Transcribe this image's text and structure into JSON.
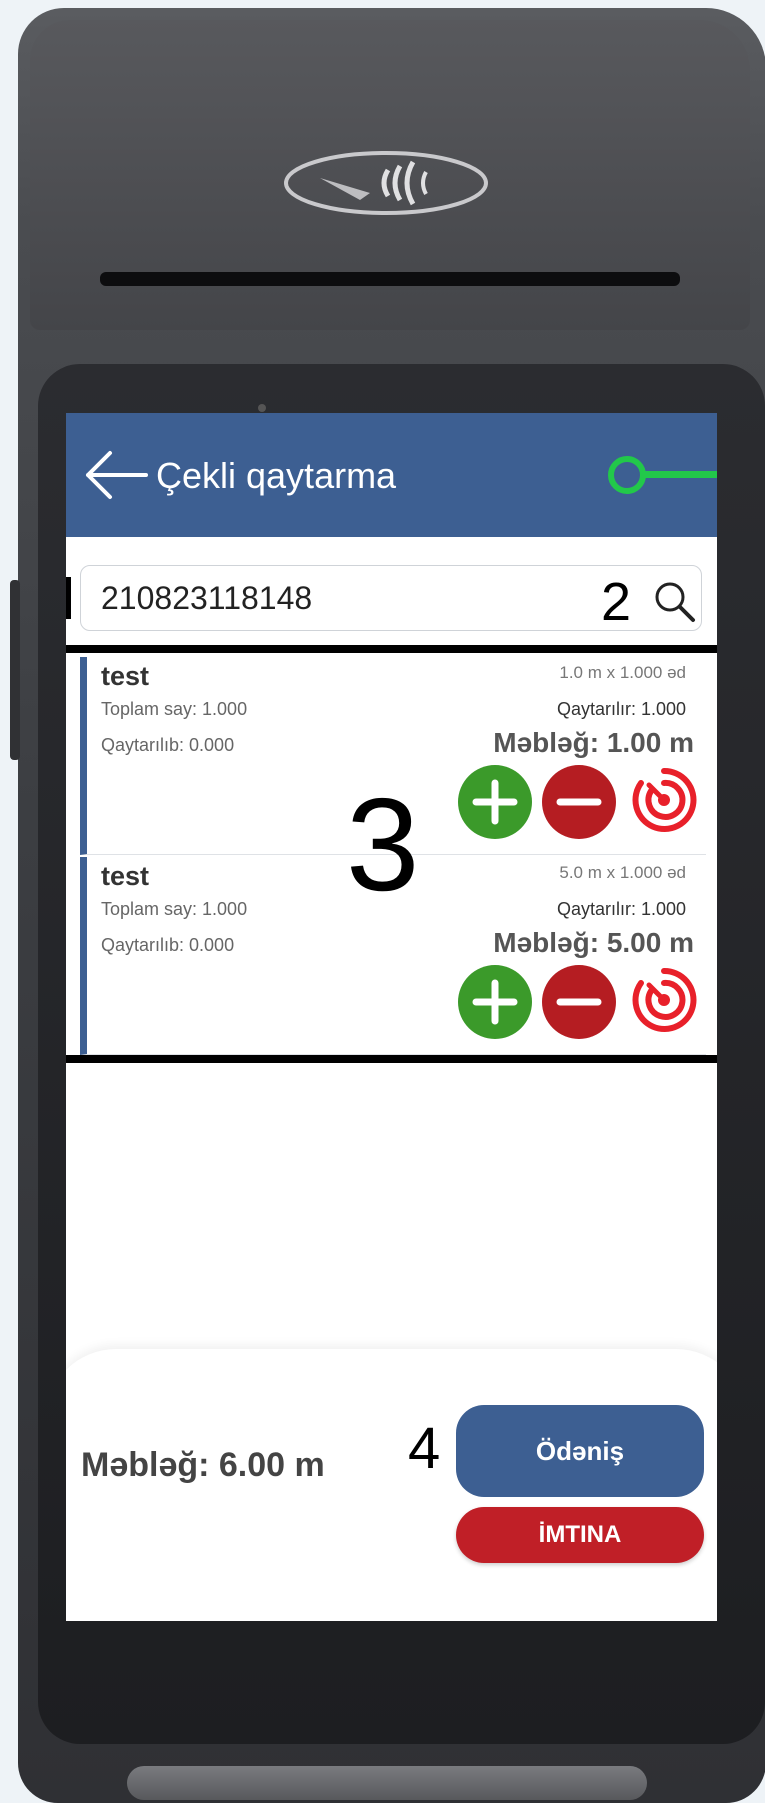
{
  "header": {
    "title": "Çekli qaytarma"
  },
  "search": {
    "value": "210823118148",
    "marker": "2"
  },
  "list_marker": "3",
  "items": [
    {
      "name": "test",
      "total_qty": "Toplam say: 1.000",
      "returned": "Qaytarılıb: 0.000",
      "price": "1.0 m x 1.000 əd",
      "returning": "Qaytarılır: 1.000",
      "amount": "Məbləğ: 1.00 m"
    },
    {
      "name": "test",
      "total_qty": "Toplam say: 1.000",
      "returned": "Qaytarılıb: 0.000",
      "price": "5.0 m x 1.000 əd",
      "returning": "Qaytarılır: 1.000",
      "amount": "Məbləğ: 5.00 m"
    }
  ],
  "footer": {
    "total": "Məbləğ: 6.00 m",
    "marker": "4",
    "pay_label": "Ödəniş",
    "cancel_label": "İMTINA"
  },
  "icons": {
    "back": "arrow-left-icon",
    "search": "search-icon",
    "plus": "plus-icon",
    "minus": "minus-icon",
    "radar": "radar-icon",
    "nfc": "contactless-icon"
  },
  "colors": {
    "appbar": "#3d5f92",
    "plus": "#3b9a2a",
    "minus": "#b51d22",
    "radar": "#e8202a",
    "cancel": "#c01f27",
    "annotation": "#22c84a"
  }
}
